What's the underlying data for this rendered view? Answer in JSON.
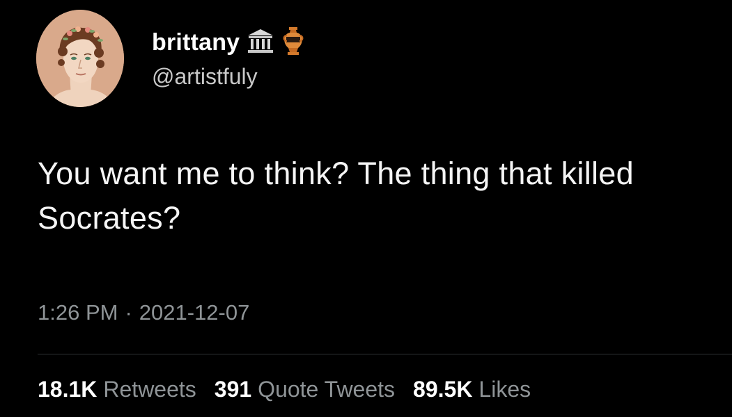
{
  "tweet": {
    "author": {
      "display_name": "brittany",
      "handle": "@artistfuly",
      "badges": [
        "classical-building-icon",
        "amphora-icon"
      ]
    },
    "text": "You want me to think? The thing that killed Socrates?",
    "time": "1:26 PM",
    "separator": "·",
    "date": "2021-12-07",
    "stats": {
      "retweets_count": "18.1K",
      "retweets_label": "Retweets",
      "quotes_count": "391",
      "quotes_label": "Quote Tweets",
      "likes_count": "89.5K",
      "likes_label": "Likes"
    }
  },
  "colors": {
    "background": "#000000",
    "primary_text": "#ffffff",
    "secondary_text": "#8f9497"
  }
}
